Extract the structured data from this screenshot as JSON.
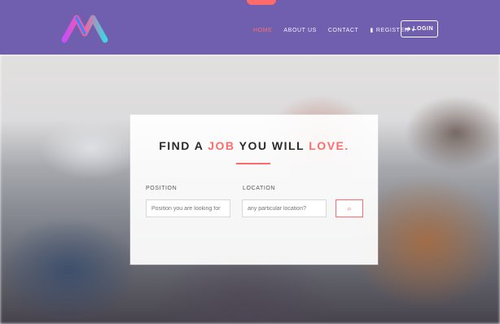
{
  "header": {
    "nav": [
      {
        "label": "HOME"
      },
      {
        "label": "ABOUT US"
      },
      {
        "label": "CONTACT"
      },
      {
        "label": "REGISTER"
      }
    ],
    "login_label": "LOGIN"
  },
  "hero": {
    "title_part1": "FIND A ",
    "title_accent1": "JOB",
    "title_part2": " YOU WILL ",
    "title_accent2": "LOVE",
    "title_end": ".",
    "position_label": "POSITION",
    "position_placeholder": "Position you are looking for",
    "location_label": "LOCATION",
    "location_placeholder": "any particular location?"
  },
  "icons": {
    "register": "user-icon",
    "dropdown": "chevron-down-icon",
    "login": "login-icon",
    "search": "search-icon"
  },
  "colors": {
    "header": "#6f5fae",
    "accent": "#ff6b6b",
    "text": "#2a2a2a"
  }
}
